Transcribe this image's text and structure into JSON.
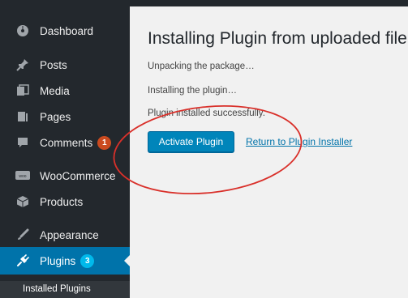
{
  "sidebar": {
    "items": [
      {
        "label": "Dashboard",
        "icon": "dashboard-icon"
      },
      {
        "label": "Posts",
        "icon": "pin-icon"
      },
      {
        "label": "Media",
        "icon": "media-icon"
      },
      {
        "label": "Pages",
        "icon": "pages-icon"
      },
      {
        "label": "Comments",
        "icon": "comment-icon",
        "badge": "1"
      },
      {
        "label": "WooCommerce",
        "icon": "woocommerce-icon"
      },
      {
        "label": "Products",
        "icon": "products-icon"
      },
      {
        "label": "Appearance",
        "icon": "appearance-icon"
      },
      {
        "label": "Plugins",
        "icon": "plugins-icon",
        "badge": "3",
        "active": true
      }
    ],
    "submenu": {
      "label": "Installed Plugins"
    }
  },
  "main": {
    "title": "Installing Plugin from uploaded file:",
    "messages": [
      "Unpacking the package…",
      "Installing the plugin…",
      "Plugin installed successfully."
    ],
    "activate_button": "Activate Plugin",
    "return_link": "Return to Plugin Installer"
  },
  "colors": {
    "sidebar_bg": "#23282d",
    "active_bg": "#0073aa",
    "comment_badge": "#ca4a1f",
    "plugins_badge": "#00b9eb",
    "primary_button": "#0085ba",
    "link": "#0073aa",
    "annotation": "#d9302a"
  }
}
